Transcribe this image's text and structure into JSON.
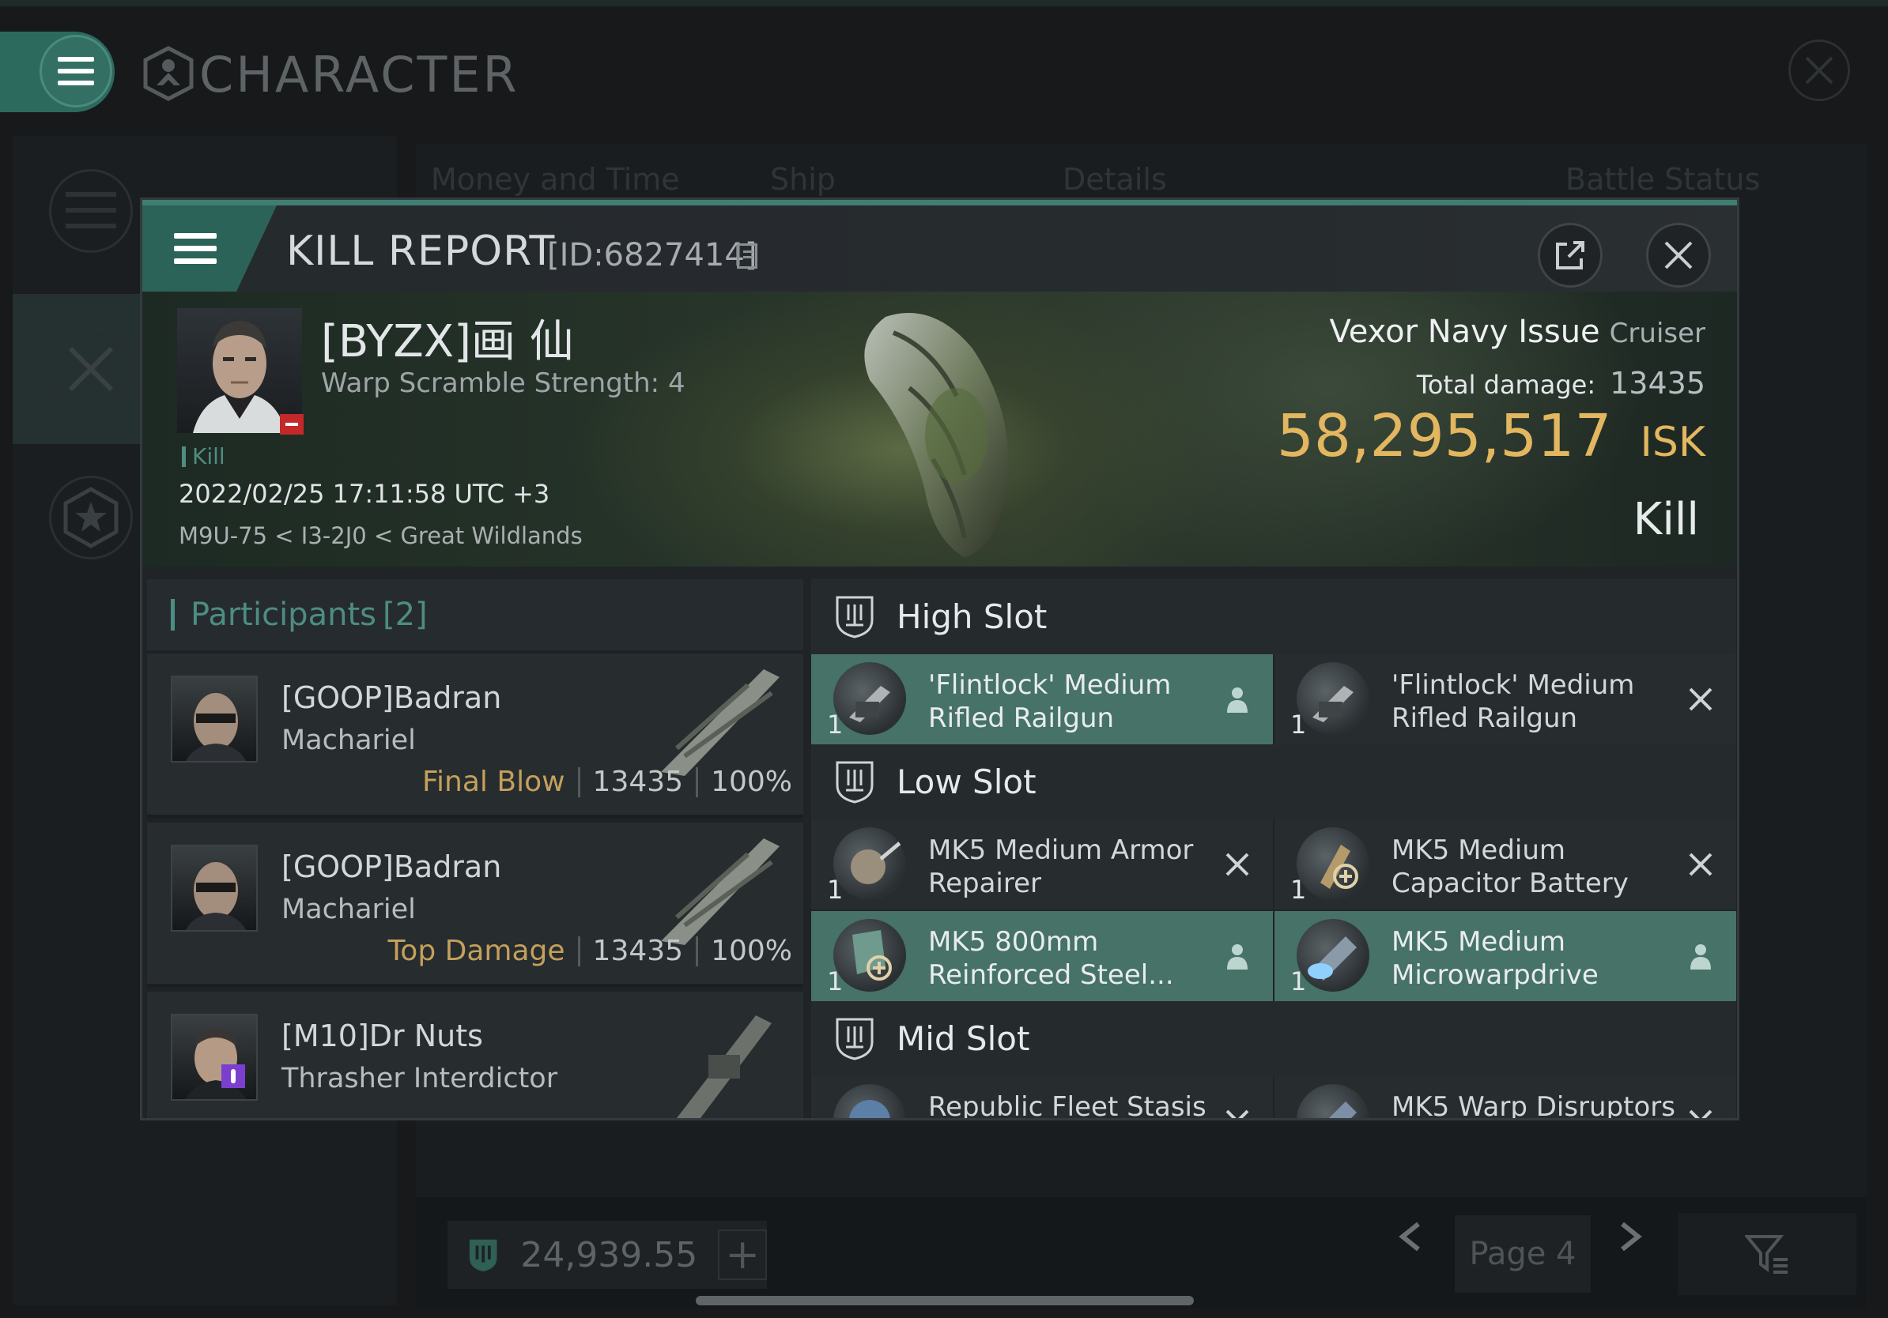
{
  "background_window": {
    "title": "CHARACTER",
    "tabs": [
      "Money and Time",
      "Ship",
      "Details",
      "Battle Status"
    ],
    "wallet_amount": "24,939.55",
    "page_label": "Page 4"
  },
  "kill_report": {
    "title": "KILL REPORT",
    "id_label": "[ID:6827414]",
    "victim": {
      "name": "[BYZX]画 仙",
      "warp_scramble": "Warp Scramble Strength: 4",
      "tag": "Kill",
      "datetime": "2022/02/25 17:11:58 UTC +3",
      "location": "M9U-75 < I3-2J0 < Great Wildlands"
    },
    "ship": {
      "name": "Vexor Navy Issue",
      "class": "Cruiser",
      "total_damage_label": "Total damage:",
      "total_damage": "13435",
      "isk_value": "58,295,517",
      "isk_unit": "ISK",
      "result": "Kill"
    },
    "participants": {
      "label": "Participants",
      "count": "[2]",
      "rows": [
        {
          "name": "[GOOP]Badran",
          "ship": "Machariel",
          "role": "Final Blow",
          "damage": "13435",
          "percent": "100%"
        },
        {
          "name": "[GOOP]Badran",
          "ship": "Machariel",
          "role": "Top Damage",
          "damage": "13435",
          "percent": "100%"
        },
        {
          "name": "[M10]Dr Nuts",
          "ship": "Thrasher Interdictor",
          "role": "",
          "damage": "",
          "percent": ""
        }
      ]
    },
    "slots": {
      "high": {
        "label": "High Slot",
        "items": [
          {
            "name": "'Flintlock' Medium Rifled Railgun",
            "qty": "1",
            "status": "dropped"
          },
          {
            "name": "'Flintlock' Medium Rifled Railgun",
            "qty": "1",
            "status": "destroyed"
          }
        ]
      },
      "low": {
        "label": "Low Slot",
        "items": [
          {
            "name": "MK5 Medium Armor Repairer",
            "qty": "1",
            "status": "destroyed"
          },
          {
            "name": "MK5 Medium Capacitor Battery",
            "qty": "1",
            "status": "destroyed"
          },
          {
            "name": "MK5 800mm Reinforced Steel...",
            "qty": "1",
            "status": "dropped"
          },
          {
            "name": "MK5 Medium Microwarpdrive",
            "qty": "1",
            "status": "dropped"
          }
        ]
      },
      "mid": {
        "label": "Mid Slot",
        "items": [
          {
            "name": "Republic Fleet Stasis",
            "qty": "",
            "status": "destroyed"
          },
          {
            "name": "MK5 Warp Disruptors",
            "qty": "",
            "status": "destroyed"
          }
        ]
      }
    }
  },
  "colors": {
    "accent_teal": "#467268",
    "isk_gold": "#e3b660",
    "role_gold": "#c4a05c",
    "loss_red": "#c42828"
  }
}
